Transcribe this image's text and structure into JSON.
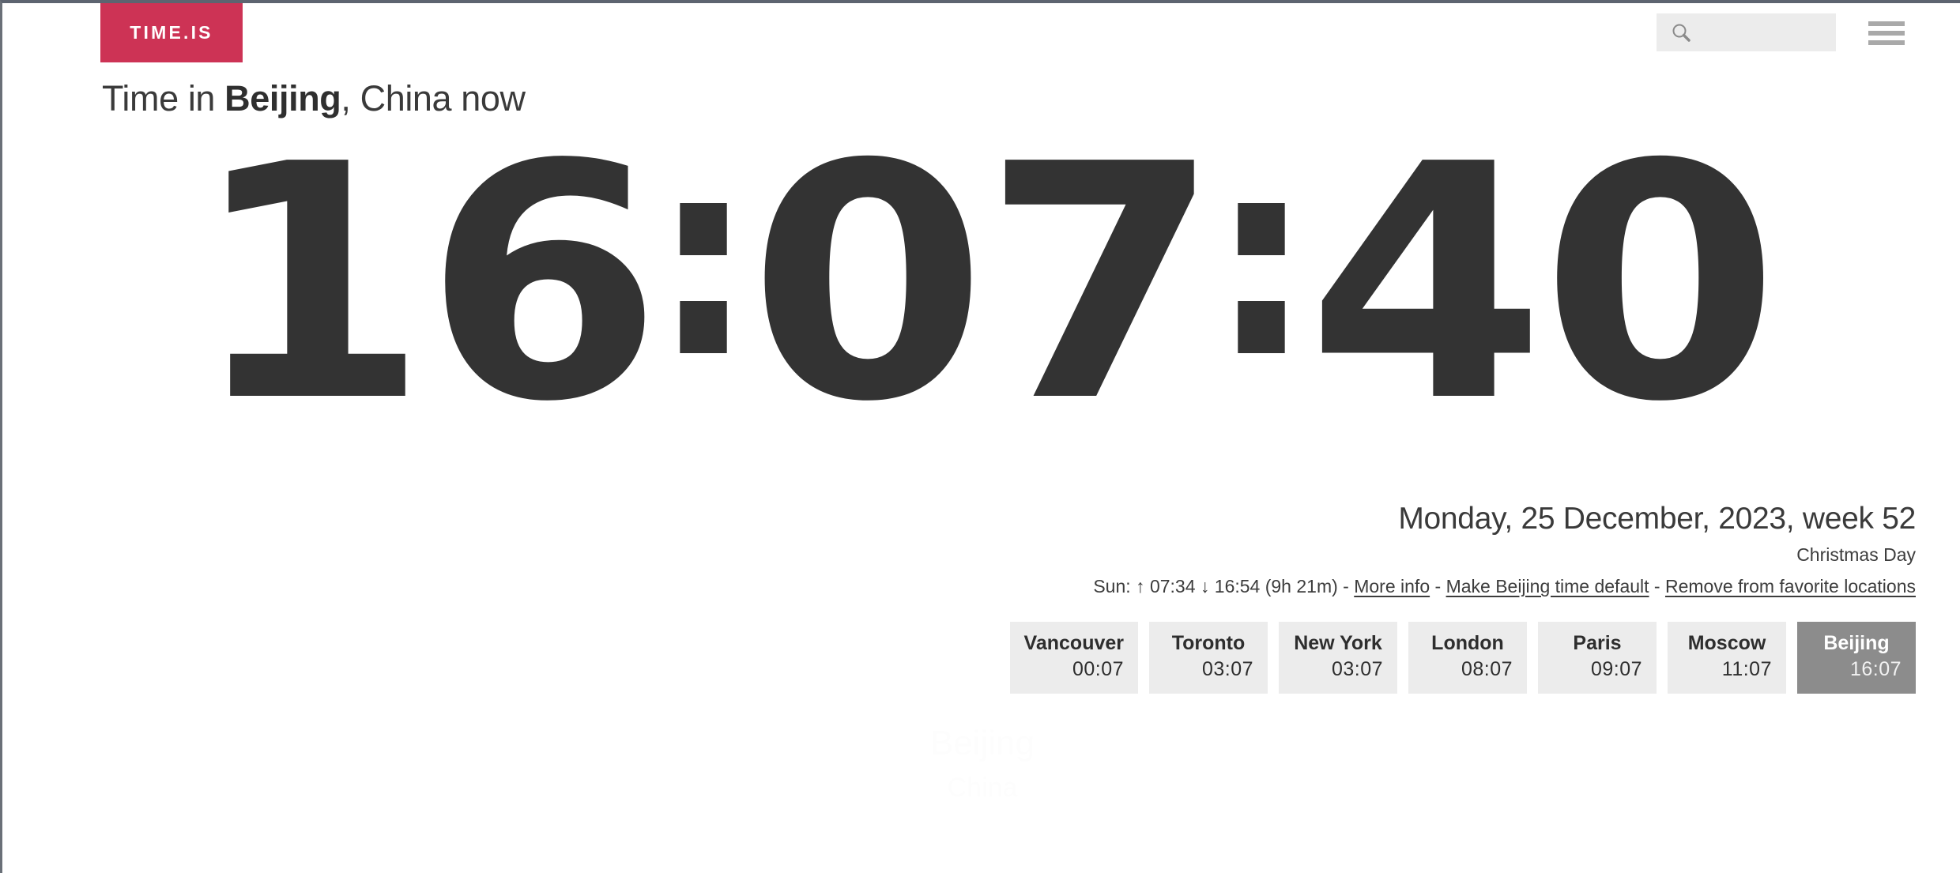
{
  "header": {
    "logo_text": "TIME.IS",
    "search": {
      "value": "",
      "placeholder": "",
      "icon": "search-icon"
    },
    "menu": {
      "icon": "hamburger-menu-icon"
    }
  },
  "headline": {
    "prefix": "Time in ",
    "city": "Beijing",
    "suffix": ", China now"
  },
  "clock": {
    "hours": "16",
    "minutes": "07",
    "seconds": "40",
    "separator": ":"
  },
  "info": {
    "date_line": "Monday, 25 December, 2023, week 52",
    "holiday": "Christmas Day",
    "sun": {
      "label": "Sun:",
      "sunrise_arrow": "↑",
      "sunrise": "07:34",
      "sunset_arrow": "↓",
      "sunset": "16:54",
      "daylength": "(9h 21m)",
      "sep": "-",
      "links": [
        "More info",
        "Make Beijing time default",
        "Remove from favorite locations"
      ]
    }
  },
  "cities": [
    {
      "name": "Vancouver",
      "time": "00:07",
      "active": false
    },
    {
      "name": "Toronto",
      "time": "03:07",
      "active": false
    },
    {
      "name": "New York",
      "time": "03:07",
      "active": false
    },
    {
      "name": "London",
      "time": "08:07",
      "active": false
    },
    {
      "name": "Paris",
      "time": "09:07",
      "active": false
    },
    {
      "name": "Moscow",
      "time": "11:07",
      "active": false
    },
    {
      "name": "Beijing",
      "time": "16:07",
      "active": true
    }
  ],
  "ghost": {
    "line1": "Beijing",
    "line2": "China"
  },
  "colors": {
    "brand_red": "#cd3355",
    "clock_dark": "#333333",
    "tile_bg": "#ececec",
    "tile_active_bg": "#8c8c8c",
    "top_border": "#5d6470",
    "menu_bar": "#a9a9a9"
  }
}
